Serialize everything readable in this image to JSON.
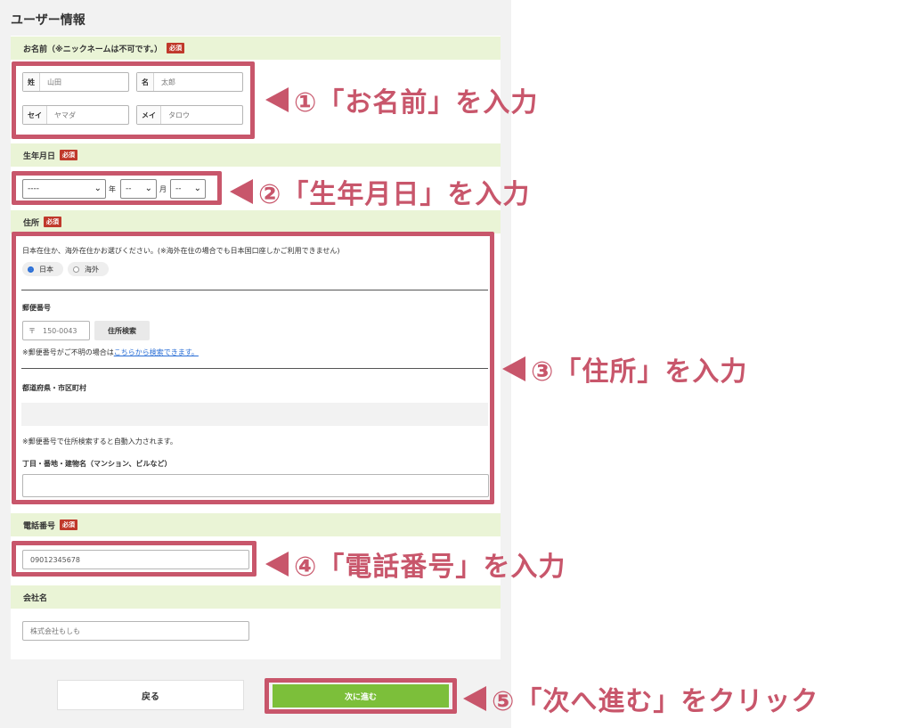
{
  "form": {
    "title": "ユーザー情報",
    "required_badge": "必須",
    "name_section": {
      "header": "お名前（※ニックネームは不可です。）",
      "sei": {
        "label": "姓",
        "value": "山田"
      },
      "mei": {
        "label": "名",
        "value": "太郎"
      },
      "sei_kana": {
        "label": "セイ",
        "value": "ヤマダ"
      },
      "mei_kana": {
        "label": "メイ",
        "value": "タロウ"
      }
    },
    "birth_section": {
      "header": "生年月日",
      "year_value": "----",
      "year_unit": "年",
      "month_value": "--",
      "month_unit": "月",
      "day_value": "--"
    },
    "address_section": {
      "header": "住所",
      "residence_question": "日本在住か、海外在住かお選びください。(※海外在住の場合でも日本国口座しかご利用できません)",
      "option_japan": "日本",
      "option_overseas": "海外",
      "zip_label": "郵便番号",
      "zip_prefix": "〒",
      "zip_value": "150-0043",
      "zip_search_button": "住所検索",
      "zip_help_prefix": "※郵便番号がご不明の場合は",
      "zip_help_link": "こちらから検索できます。",
      "pref_city_label": "都道府県・市区町村",
      "auto_fill_note": "※郵便番号で住所検索すると自動入力されます。",
      "street_label": "丁目・番地・建物名（マンション、ビルなど）"
    },
    "phone_section": {
      "header": "電話番号",
      "value": "09012345678"
    },
    "company_section": {
      "header": "会社名",
      "placeholder": "株式会社もしも"
    },
    "buttons": {
      "back": "戻る",
      "next": "次に進む"
    }
  },
  "annotations": {
    "a1": "①「お名前」を入力",
    "a2": "②「生年月日」を入力",
    "a3": "③「住所」を入力",
    "a4": "④「電話番号」を入力",
    "a5": "⑤「次へ進む」をクリック"
  },
  "colors": {
    "highlight": "#c8566b",
    "section_header": "#eaf4d6",
    "next_button": "#7cbf3a",
    "required_badge": "#c0392b"
  }
}
